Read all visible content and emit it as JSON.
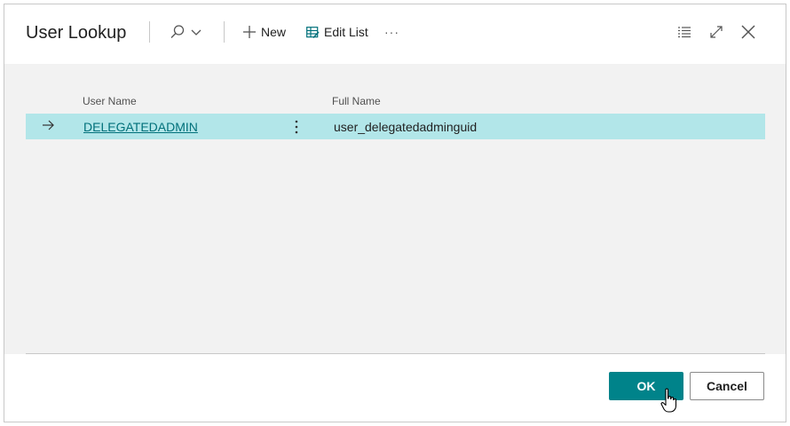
{
  "dialog": {
    "title": "User Lookup",
    "toolbar": {
      "search_icon": "search-icon",
      "new_label": "New",
      "edit_list_label": "Edit List",
      "more_label": "···"
    },
    "window_controls": [
      "list-icon",
      "expand-icon",
      "close-icon"
    ]
  },
  "table": {
    "columns": [
      "User Name",
      "Full Name"
    ],
    "rows": [
      {
        "user_name": "DELEGATEDADMIN",
        "full_name": "user_delegatedadminguid",
        "selected": true
      }
    ]
  },
  "footer": {
    "ok_label": "OK",
    "cancel_label": "Cancel"
  },
  "colors": {
    "accent": "#00838a",
    "row_selected": "#b2e6e9",
    "link": "#00707a"
  }
}
